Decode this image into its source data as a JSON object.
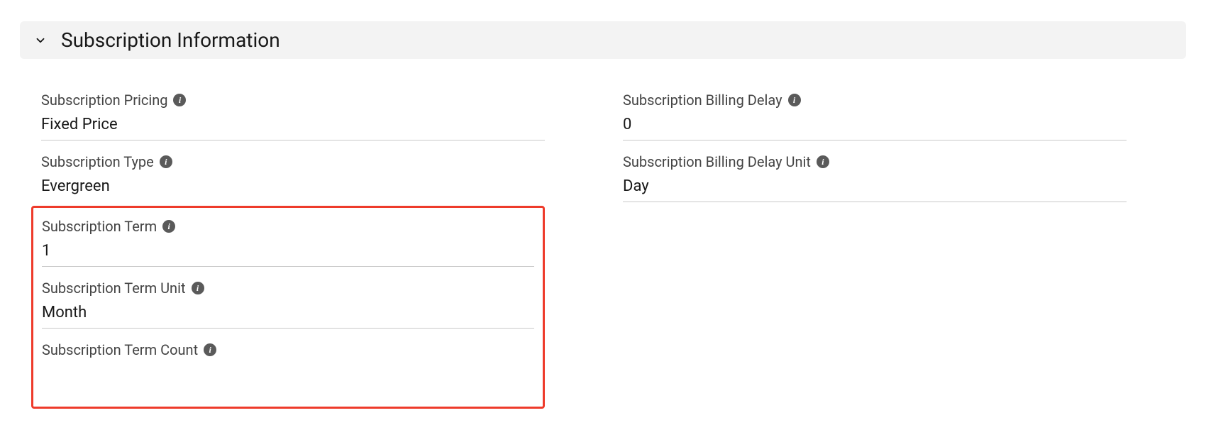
{
  "section": {
    "title": "Subscription Information"
  },
  "left": {
    "pricing": {
      "label": "Subscription Pricing",
      "value": "Fixed Price"
    },
    "type": {
      "label": "Subscription Type",
      "value": "Evergreen"
    },
    "term": {
      "label": "Subscription Term",
      "value": "1"
    },
    "term_unit": {
      "label": "Subscription Term Unit",
      "value": "Month"
    },
    "term_count": {
      "label": "Subscription Term Count",
      "value": ""
    }
  },
  "right": {
    "billing_delay": {
      "label": "Subscription Billing Delay",
      "value": "0"
    },
    "billing_delay_unit": {
      "label": "Subscription Billing Delay Unit",
      "value": "Day"
    }
  }
}
